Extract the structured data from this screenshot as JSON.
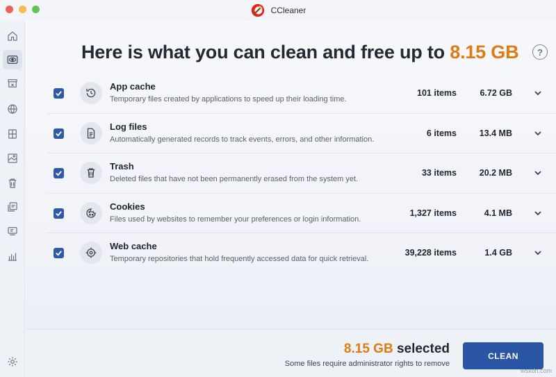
{
  "window": {
    "title": "CCleaner",
    "traffic_colors": [
      "#ee5f57",
      "#f5bd4f",
      "#61c454"
    ]
  },
  "sidebar": {
    "items": [
      {
        "icon": "home-icon"
      },
      {
        "icon": "eye-icon",
        "active": true
      },
      {
        "icon": "archive-box-icon"
      },
      {
        "icon": "globe-icon"
      },
      {
        "icon": "apps-icon"
      },
      {
        "icon": "photo-icon"
      },
      {
        "icon": "trash-icon"
      },
      {
        "icon": "duplicates-icon"
      },
      {
        "icon": "monitor-icon"
      },
      {
        "icon": "chart-icon"
      }
    ],
    "bottom_icon": "settings-icon"
  },
  "main": {
    "headline": {
      "prefix": "Here is what you can clean and free up to ",
      "amount": "8.15 GB"
    },
    "help_label": "?"
  },
  "rows": [
    {
      "icon": "clock-icon",
      "title": "App cache",
      "desc": "Temporary files created by applications to speed up their loading time.",
      "items": "101 items",
      "size": "6.72 GB",
      "checked": true
    },
    {
      "icon": "document-icon",
      "title": "Log files",
      "desc": "Automatically generated records to track events, errors, and other information.",
      "items": "6 items",
      "size": "13.4 MB",
      "checked": true
    },
    {
      "icon": "trash-icon",
      "title": "Trash",
      "desc": "Deleted files that have not been permanently erased from the system yet.",
      "items": "33 items",
      "size": "20.2 MB",
      "checked": true
    },
    {
      "icon": "cookie-icon",
      "title": "Cookies",
      "desc": "Files used by websites to remember your preferences or login information.",
      "items": "1,327 items",
      "size": "4.1 MB",
      "checked": true
    },
    {
      "icon": "crosshair-icon",
      "title": "Web cache",
      "desc": "Temporary repositories that hold frequently accessed data for quick retrieval.",
      "items": "39,228 items",
      "size": "1.4 GB",
      "checked": true
    }
  ],
  "footer": {
    "selected_amount": "8.15 GB",
    "selected_suffix": " selected",
    "note": "Some files require administrator rights to remove",
    "clean_label": "CLEAN"
  },
  "watermark": "wsxdn.com",
  "colors": {
    "accent_orange": "#e07b14",
    "primary_blue": "#2a55a5"
  }
}
